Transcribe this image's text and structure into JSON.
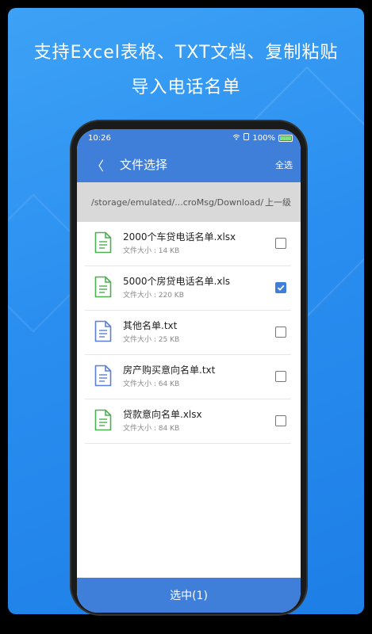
{
  "headline": {
    "line1": "支持Excel表格、TXT文档、复制粘贴",
    "line2": "导入电话名单"
  },
  "status": {
    "time": "10:26",
    "battery": "100%"
  },
  "appbar": {
    "back": "〈",
    "title": "文件选择",
    "select_all": "全选"
  },
  "path": {
    "current": "/storage/emulated/...croMsg/Download/",
    "up_label": "上一级"
  },
  "files": [
    {
      "name": "2000个车贷电话名单.xlsx",
      "size": "文件大小 : 14 KB",
      "type": "xlsx",
      "checked": false
    },
    {
      "name": "5000个房贷电话名单.xls",
      "size": "文件大小 : 220 KB",
      "type": "xlsx",
      "checked": true
    },
    {
      "name": "其他名单.txt",
      "size": "文件大小 : 25 KB",
      "type": "txt",
      "checked": false
    },
    {
      "name": "房产购买意向名单.txt",
      "size": "文件大小 : 64 KB",
      "type": "txt",
      "checked": false
    },
    {
      "name": "贷款意向名单.xlsx",
      "size": "文件大小 : 84 KB",
      "type": "xlsx",
      "checked": false
    }
  ],
  "bottom": {
    "selected_label": "选中(1)"
  },
  "colors": {
    "accent": "#3f7fd9",
    "excel_icon": "#4caf50",
    "txt_icon": "#5b7fd4"
  }
}
